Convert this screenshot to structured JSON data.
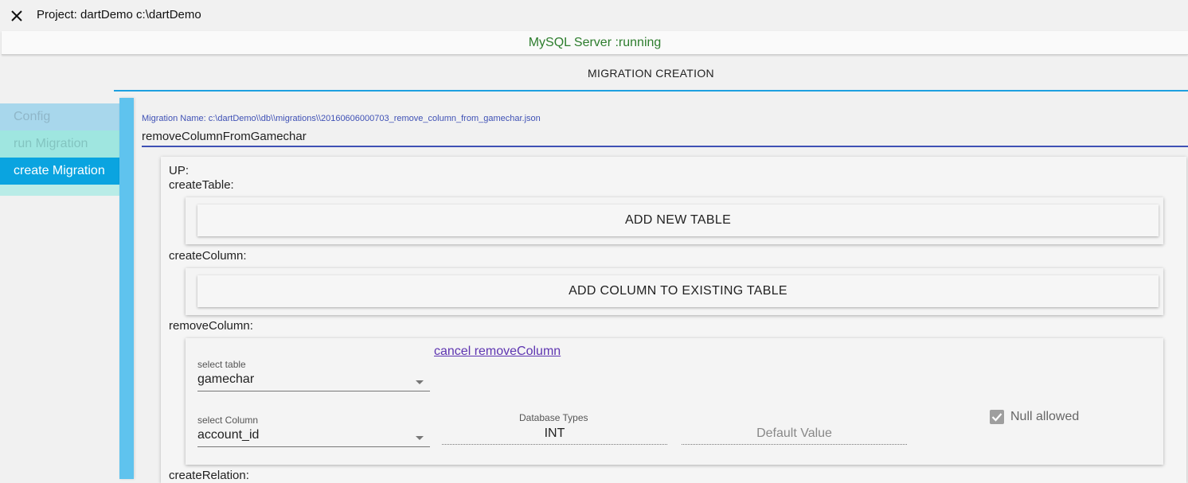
{
  "window": {
    "title": "Project: dartDemo c:\\dartDemo",
    "close_icon": "close-icon"
  },
  "status": {
    "text": "MySQL Server :running",
    "color": "#2d7d2d"
  },
  "tab": {
    "label": "MIGRATION CREATION",
    "accent": "#1ea0e0"
  },
  "sidebar": {
    "items": [
      {
        "label": "Config",
        "state": "disabled"
      },
      {
        "label": "run Migration",
        "state": "disabled"
      },
      {
        "label": "create Migration",
        "state": "selected"
      }
    ]
  },
  "migration": {
    "label": "Migration Name: c:\\dartDemo\\\\db\\\\migrations\\\\20160606000703_remove_column_from_gamechar.json",
    "value": "removeColumnFromGamechar"
  },
  "sections": {
    "up": "UP:",
    "create_table": "createTable:",
    "create_column": "createColumn:",
    "remove_column": "removeColumn:",
    "create_relation": "createRelation:"
  },
  "buttons": {
    "add_table": "ADD NEW TABLE",
    "add_column": "ADD COLUMN TO EXISTING TABLE"
  },
  "remove_column_form": {
    "cancel_label": "cancel removeColumn",
    "select_table_label": "select table",
    "select_table_value": "gamechar",
    "select_column_label": "select Column",
    "select_column_value": "account_id",
    "db_types_label": "Database Types",
    "db_type_value": "INT",
    "default_value_placeholder": "Default Value",
    "null_allowed_label": "Null allowed",
    "null_allowed_checked": true
  }
}
